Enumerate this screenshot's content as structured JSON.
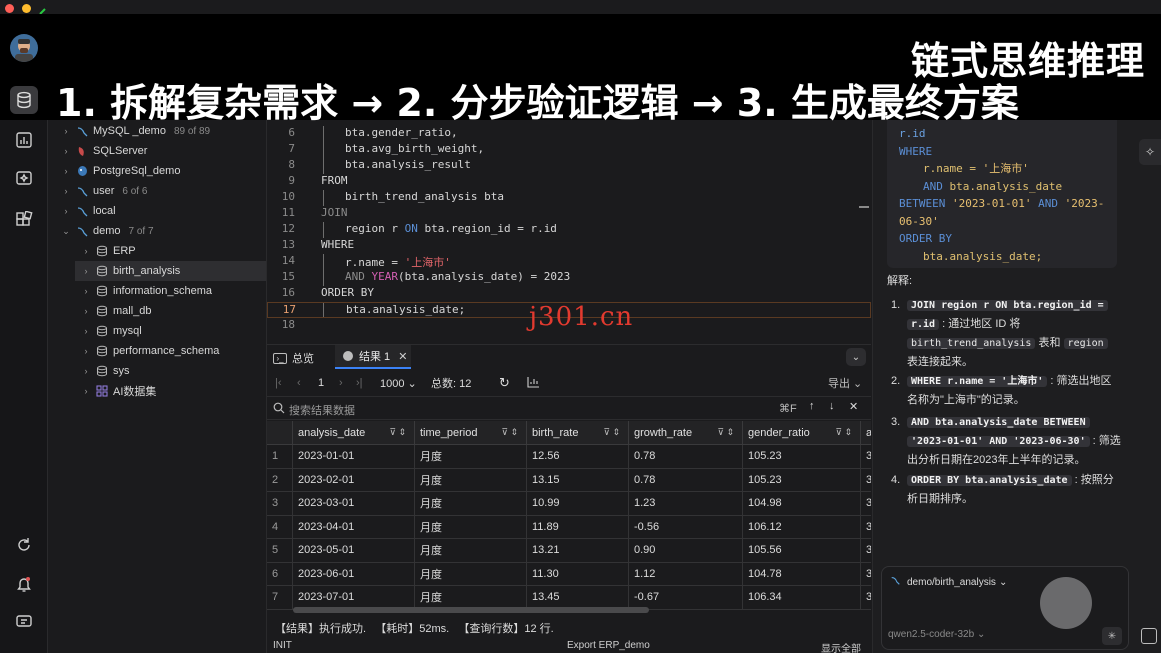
{
  "banner": {
    "line1": "链式思维推理",
    "line2": "1. 拆解复杂需求 → 2. 分步验证逻辑 → 3. 生成最终方案"
  },
  "tree": {
    "items": [
      {
        "label": "MySQL _demo",
        "count": "89 of 89",
        "icon": "mysql-icon"
      },
      {
        "label": "SQLServer",
        "count": "",
        "icon": "sqlserver-icon"
      },
      {
        "label": "PostgreSql_demo",
        "count": "",
        "icon": "postgres-icon"
      },
      {
        "label": "user",
        "count": "6 of 6",
        "icon": "mysql-icon"
      },
      {
        "label": "local",
        "count": "",
        "icon": "mysql-icon"
      },
      {
        "label": "demo",
        "count": "7 of 7",
        "icon": "mysql-icon"
      },
      {
        "label": "ERP",
        "count": "",
        "icon": "database-icon"
      },
      {
        "label": "birth_analysis",
        "count": "",
        "icon": "database-icon"
      },
      {
        "label": "information_schema",
        "count": "",
        "icon": "database-icon"
      },
      {
        "label": "mall_db",
        "count": "",
        "icon": "database-icon"
      },
      {
        "label": "mysql",
        "count": "",
        "icon": "database-icon"
      },
      {
        "label": "performance_schema",
        "count": "",
        "icon": "database-icon"
      },
      {
        "label": "sys",
        "count": "",
        "icon": "database-icon"
      },
      {
        "label": "AI数据集",
        "count": "",
        "icon": "dataset-icon"
      }
    ]
  },
  "editor": {
    "line_numbers": [
      "6",
      "7",
      "8",
      "9",
      "10",
      "11",
      "12",
      "13",
      "14",
      "15",
      "16",
      "17",
      "18"
    ],
    "watermark": "j301.cn",
    "code": {
      "l6": "bta.gender_ratio,",
      "l7": "bta.avg_birth_weight,",
      "l8": "bta.analysis_result",
      "l9": "FROM",
      "l10": "birth_trend_analysis bta",
      "l11": "JOIN",
      "l12a": "region r ",
      "l12b": "ON",
      "l12c": " bta.region_id = r.id",
      "l13": "WHERE",
      "l14a": "r.name = ",
      "l14b": "'上海市'",
      "l15a": "AND ",
      "l15b": "YEAR",
      "l15c": "(bta.analysis_date) = 2023",
      "l16": "ORDER BY",
      "l17": "bta.analysis_date;"
    }
  },
  "results_tabs": {
    "overview": "总览",
    "result": "结果 1"
  },
  "pager": {
    "page": "1",
    "page_size": "1000",
    "total_label": "总数:",
    "total": "12",
    "export": "导出"
  },
  "search": {
    "placeholder": "搜索结果数据",
    "shortcut": "⌘F"
  },
  "table": {
    "columns": [
      "analysis_date",
      "time_period",
      "birth_rate",
      "growth_rate",
      "gender_ratio",
      "a"
    ],
    "rows": [
      [
        "1",
        "2023-01-01",
        "月度",
        "12.56",
        "0.78",
        "105.23",
        "3"
      ],
      [
        "2",
        "2023-02-01",
        "月度",
        "13.15",
        "0.78",
        "105.23",
        "3"
      ],
      [
        "3",
        "2023-03-01",
        "月度",
        "10.99",
        "1.23",
        "104.98",
        "3"
      ],
      [
        "4",
        "2023-04-01",
        "月度",
        "11.89",
        "-0.56",
        "106.12",
        "3"
      ],
      [
        "5",
        "2023-05-01",
        "月度",
        "13.21",
        "0.90",
        "105.56",
        "3"
      ],
      [
        "6",
        "2023-06-01",
        "月度",
        "11.30",
        "1.12",
        "104.78",
        "3"
      ],
      [
        "7",
        "2023-07-01",
        "月度",
        "13.45",
        "-0.67",
        "106.34",
        "3"
      ]
    ],
    "partial_row_value": "月度"
  },
  "status": {
    "message": "【结果】执行成功.   【耗时】52ms.   【查询行数】12 行.",
    "mode": "INIT",
    "export_label": "Export ERP_demo",
    "show_all": "显示全部"
  },
  "chat": {
    "code_lines": {
      "c1": "r.id",
      "c2": "WHERE",
      "c3a": "r.name = ",
      "c3b": "'上海市'",
      "c4a": "AND",
      "c4b": " bta.analysis_date",
      "c5a": "BETWEEN ",
      "c5b": "'2023-01-01'",
      "c5c": " AND ",
      "c5d": "'2023-",
      "c6": "06-30'",
      "c7": "ORDER BY",
      "c8": "bta.analysis_date;"
    },
    "explain_label": "解释:",
    "items": {
      "i1_code": "JOIN region r ON bta.region_id =",
      "i1_code2": "r.id",
      "i1_t1": ": 通过地区 ID 将",
      "i1_code3": "birth_trend_analysis",
      "i1_t2": "表和",
      "i1_code4": "region",
      "i1_t3": "表连接起来。",
      "i2_code": "WHERE r.name = '上海市'",
      "i2_t1": ": 筛选出地区",
      "i2_t2": "名称为\"上海市\"的记录。",
      "i3_code": "AND bta.analysis_date BETWEEN",
      "i3_code2": "'2023-01-01' AND '2023-06-30'",
      "i3_t1": ": 筛选",
      "i3_t2": "出分析日期在2023年上半年的记录。",
      "i4_code": "ORDER BY bta.analysis_date",
      "i4_t1": ": 按照分",
      "i4_t2": "析日期排序。"
    },
    "context": "demo/birth_analysis",
    "model": "qwen2.5-coder-32b"
  }
}
